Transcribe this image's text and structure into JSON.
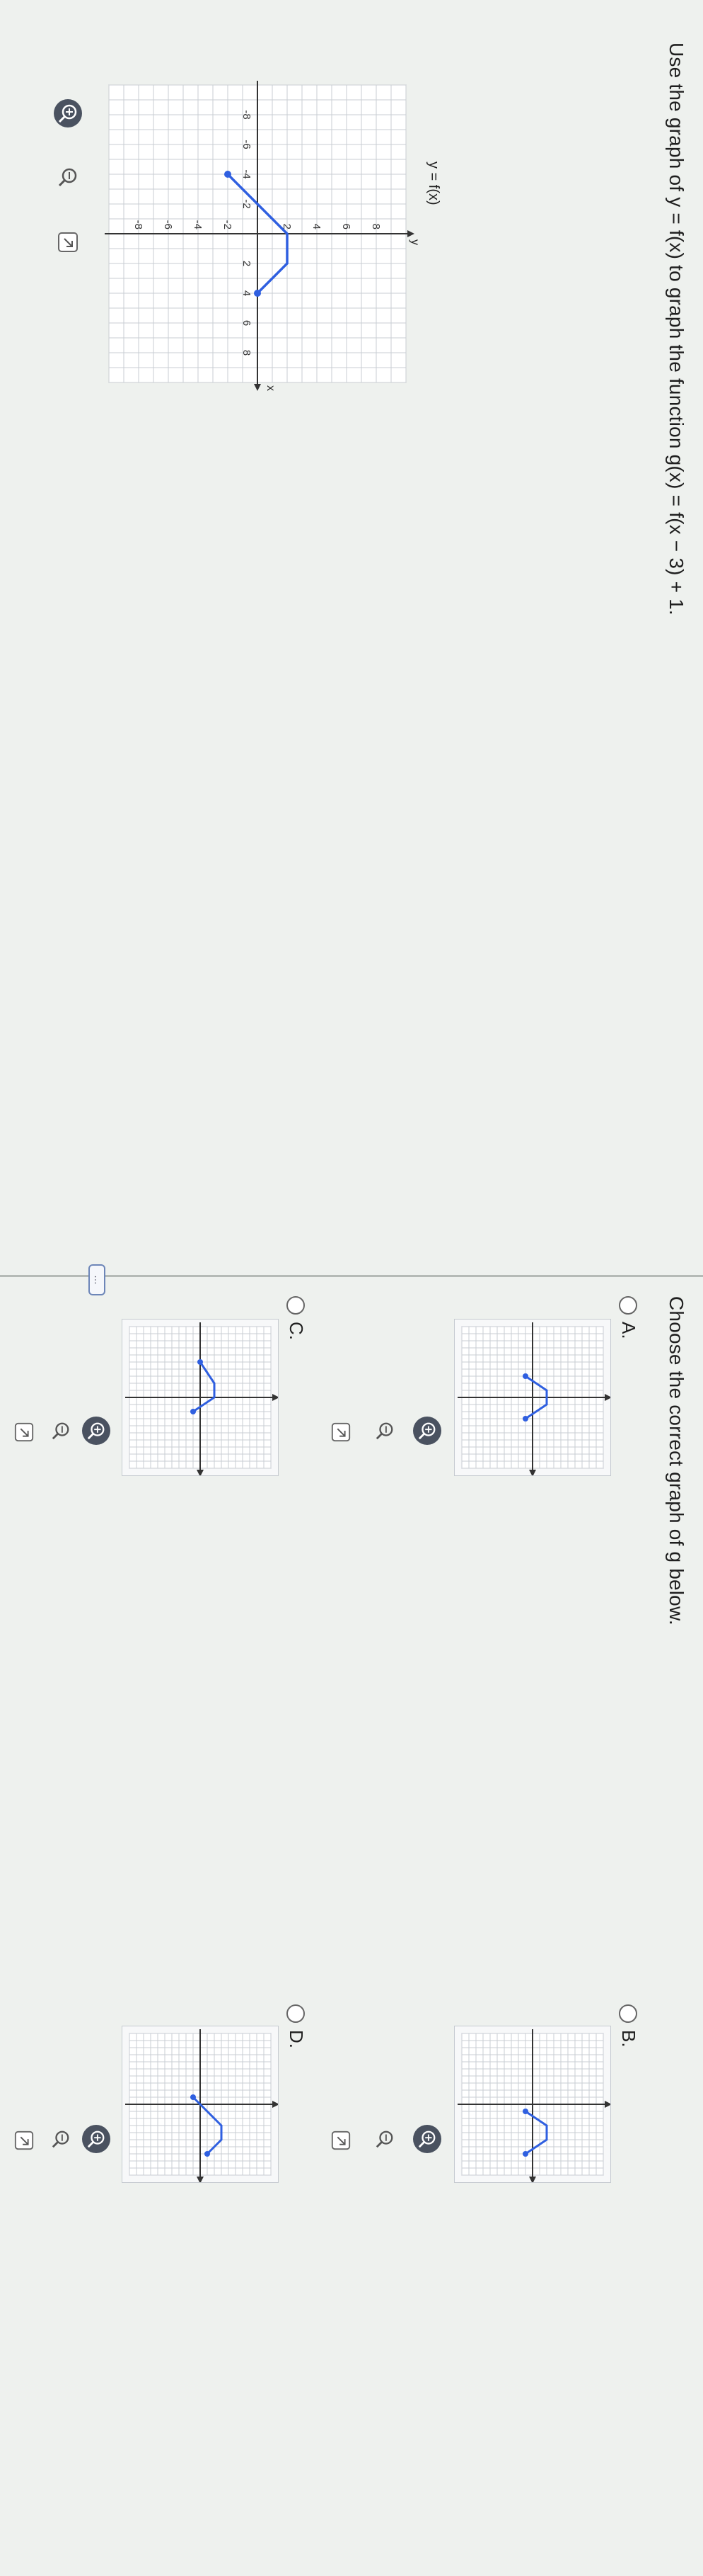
{
  "question": {
    "text": "Use the graph of y = f(x) to graph the function g(x) = f(x − 3) + 1.",
    "graph_title": "y = f(x)",
    "axis_x": "x",
    "axis_y": "y",
    "ticks_x": [
      "-8",
      "-6",
      "-4",
      "-2",
      "2",
      "4",
      "6",
      "8"
    ],
    "ticks_y": [
      "8",
      "6",
      "4",
      "2",
      "-2",
      "-4",
      "-6",
      "-8"
    ]
  },
  "answer": {
    "prompt": "Choose the correct graph of g below.",
    "more_label": "…",
    "options": [
      {
        "label": "A."
      },
      {
        "label": "B."
      },
      {
        "label": "C."
      },
      {
        "label": "D."
      }
    ]
  },
  "icons": {
    "zoom_in": "zoom-in-icon",
    "zoom_out": "zoom-out-icon",
    "popout": "popout-icon"
  },
  "colors": {
    "graph_line": "#2f5fe0",
    "grid": "#c9cdd3",
    "axis": "#333333"
  }
}
